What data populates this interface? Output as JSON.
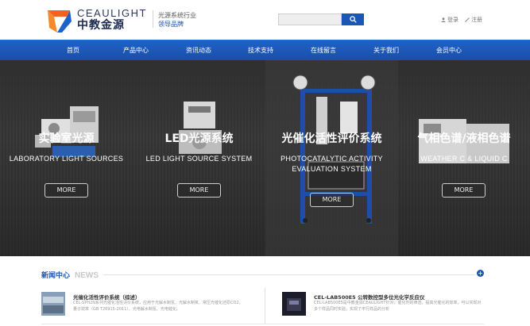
{
  "header": {
    "brand_en": "CEAULIGHT",
    "brand_cn": "中教金源",
    "tagline_1": "光源系统行业",
    "tagline_2": "领导品牌",
    "search_placeholder": "",
    "login": "登录",
    "register": "注册"
  },
  "nav": {
    "items": [
      "首页",
      "产品中心",
      "资讯动态",
      "技术支持",
      "在线留言",
      "关于我们",
      "会员中心"
    ]
  },
  "hero": {
    "panels": [
      {
        "title": "实验室光源",
        "subtitle": "LABORATORY LIGHT SOURCES",
        "subtitle_2": "",
        "more": "MORE"
      },
      {
        "title": "LED光源系统",
        "subtitle": "LED LIGHT SOURCE SYSTEM",
        "subtitle_2": "",
        "more": "MORE"
      },
      {
        "title": "光催化活性评价系统",
        "subtitle": "PHOTOCATALYTIC ACTIVITY",
        "subtitle_2": "EVALUATION SYSTEM",
        "more": "MORE"
      },
      {
        "title": "气相色谱/液相色谱",
        "subtitle": "WEATHER C & LIQUID C",
        "subtitle_2": "",
        "more": "MORE"
      }
    ]
  },
  "news": {
    "title": "新闻中心",
    "title_en": "NEWS",
    "items": [
      {
        "title": "光催化活性评价系统（综述）",
        "desc": "CEL-SPH2N系列光催化活性评价系统，应用于光解水制氢、光解水制氧、常压光催化还原CO2，量子效率（GB T26915-2011）、光电解水制氢、光电催化。"
      },
      {
        "title": "CEL-LAB500E5 公转数控型多位光化学反应仪",
        "desc": "CEL-LAB500E5是中教金源CEAULIGHT针对，催化剂的筛选，提高光催化的效率，可以实现对多个样品同时实验，实现了平行样品的分析"
      }
    ]
  },
  "colors": {
    "brand_blue": "#1a56b4",
    "logo_orange": "#f0651e",
    "logo_blue": "#1e62c8"
  }
}
